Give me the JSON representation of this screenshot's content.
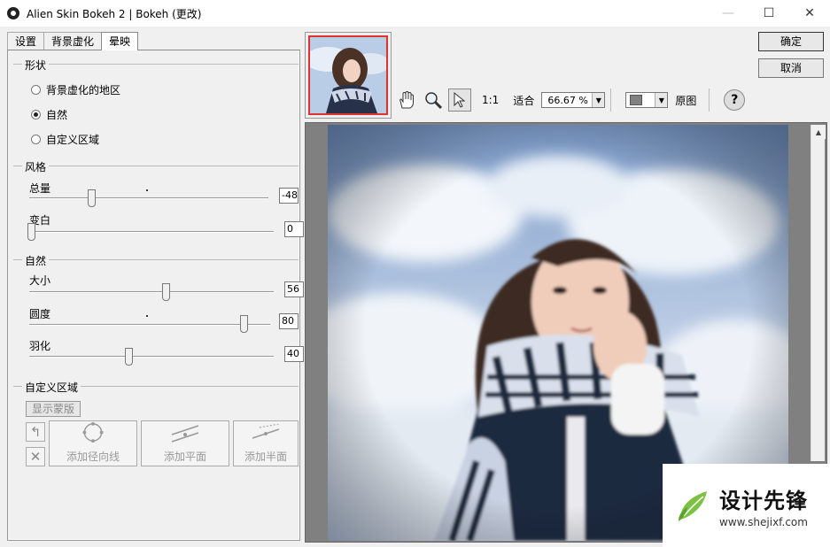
{
  "window": {
    "title": "Alien Skin Bokeh 2 | Bokeh (更改)",
    "minimize": "—",
    "maximize": "☐",
    "close": "✕"
  },
  "tabs": [
    {
      "label": "设置"
    },
    {
      "label": "背景虚化"
    },
    {
      "label": "晕映"
    }
  ],
  "shape_group": {
    "title": "形状",
    "options": [
      {
        "label": "背景虚化的地区",
        "checked": false
      },
      {
        "label": "自然",
        "checked": true
      },
      {
        "label": "自定义区域",
        "checked": false
      }
    ]
  },
  "style_group": {
    "title": "风格",
    "amount": {
      "label": "总量",
      "value": "-48"
    },
    "whiten": {
      "label": "变白",
      "value": "0"
    }
  },
  "natural_group": {
    "title": "自然",
    "size": {
      "label": "大小",
      "value": "56"
    },
    "roundness": {
      "label": "圆度",
      "value": "80"
    },
    "feather": {
      "label": "羽化",
      "value": "40"
    }
  },
  "custom_group": {
    "title": "自定义区域",
    "show_mask": "显示蒙版",
    "add_radial": "添加径向线",
    "add_plane": "添加平面",
    "add_half_plane": "添加半面"
  },
  "buttons": {
    "ok": "确定",
    "cancel": "取消"
  },
  "toolbar": {
    "one_to_one": "1:1",
    "fit": "适合",
    "zoom": "66.67 %",
    "original": "原图",
    "help": "?",
    "swatch_color": "#808080"
  },
  "watermark": {
    "name": "设计先锋",
    "url": "www.shejixf.com",
    "accent": "#7cc242"
  }
}
